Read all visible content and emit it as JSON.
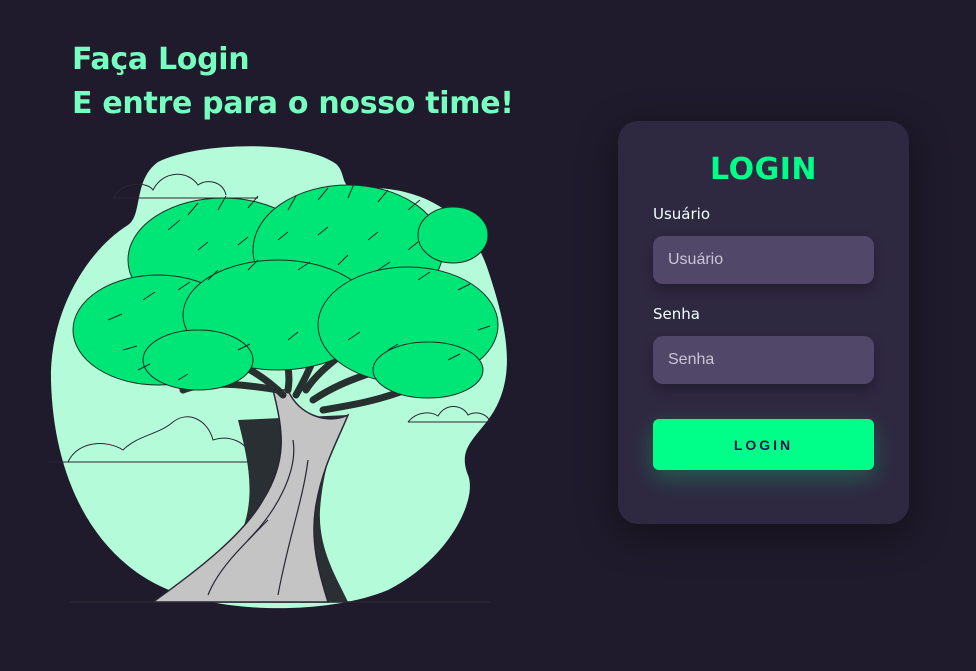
{
  "headline": {
    "line1": "Faça Login",
    "line2": "E entre para o nosso time!"
  },
  "illustration": {
    "subject": "tree-illustration",
    "blob_color": "#b4fcd9",
    "leaf_color": "#00e676",
    "trunk_color": "#c4c4c4"
  },
  "login_card": {
    "title": "LOGIN",
    "username": {
      "label": "Usuário",
      "placeholder": "Usuário",
      "value": ""
    },
    "password": {
      "label": "Senha",
      "placeholder": "Senha",
      "value": ""
    },
    "submit_label": "LOGIN"
  },
  "colors": {
    "background": "#201b2c",
    "card": "#2f2841",
    "input": "#514869",
    "accent": "#00ff88",
    "headline": "#77ffc0"
  }
}
